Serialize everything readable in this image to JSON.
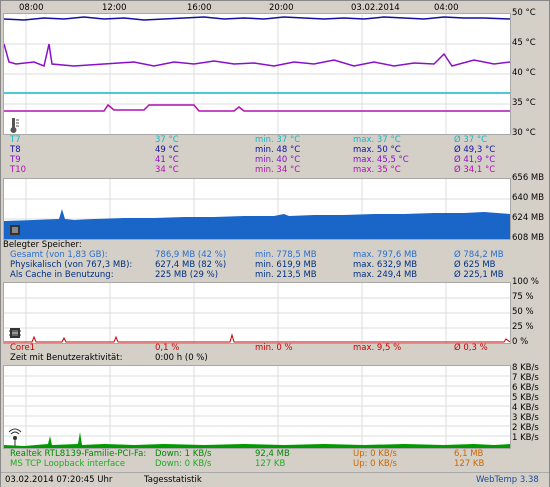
{
  "app": {
    "title": "WebTemp 3.38"
  },
  "time_axis": {
    "labels": [
      "08:00",
      "12:00",
      "16:00",
      "20:00",
      "03.02.2014",
      "04:00"
    ]
  },
  "temp_panel": {
    "y_labels": [
      "50 °C",
      "45 °C",
      "40 °C",
      "35 °C",
      "30 °C"
    ],
    "rows": [
      {
        "name": "T7",
        "current": "37 °C",
        "min": "min.  37 °C",
        "max": "max.  37 °C",
        "avg": "Ø 37 °C",
        "color": "#11b8c8"
      },
      {
        "name": "T8",
        "current": "49 °C",
        "min": "min.  48 °C",
        "max": "max.  50 °C",
        "avg": "Ø 49,3 °C",
        "color": "#1010a0"
      },
      {
        "name": "T9",
        "current": "41 °C",
        "min": "min.  40 °C",
        "max": "max.  45,5 °C",
        "avg": "Ø 41,9 °C",
        "color": "#8a10c8"
      },
      {
        "name": "T10",
        "current": "34 °C",
        "min": "min.  34 °C",
        "max": "max.  35 °C",
        "avg": "Ø 34,1 °C",
        "color": "#b010b0"
      }
    ],
    "chart_data": {
      "type": "line",
      "ylim": [
        30,
        50
      ],
      "series": [
        {
          "name": "T7",
          "values": [
            37,
            37,
            37,
            37,
            37,
            37,
            37,
            37,
            37,
            37,
            37,
            37
          ]
        },
        {
          "name": "T8",
          "values": [
            49,
            49.5,
            49,
            49,
            49.5,
            49,
            49,
            49.3,
            49,
            49,
            49.5,
            49
          ]
        },
        {
          "name": "T9",
          "values": [
            41,
            41,
            41.5,
            41,
            41,
            42,
            41,
            41.5,
            42,
            41,
            41,
            41
          ]
        },
        {
          "name": "T10",
          "values": [
            34,
            34,
            34,
            34,
            35,
            35,
            34,
            34,
            34,
            34,
            34,
            34
          ]
        }
      ]
    }
  },
  "mem_panel": {
    "y_labels": [
      "656 MB",
      "640 MB",
      "624 MB",
      "608 MB"
    ],
    "header": "Belegter Speicher:",
    "rows": [
      {
        "name": "Gesamt (von 1,83 GB):",
        "current": "786,9 MB (42 %)",
        "min": "min.  778,5 MB",
        "max": "max.  797,6 MB",
        "avg": "Ø 784,2 MB",
        "color": "#2a6ecc"
      },
      {
        "name": "Physikalisch (von 767,3 MB):",
        "current": "627,4 MB (82 %)",
        "min": "min.  619,9 MB",
        "max": "max.  632,9 MB",
        "avg": "Ø 625 MB",
        "color": "#003080"
      },
      {
        "name": "Als Cache in Benutzung:",
        "current": "225 MB (29 %)",
        "min": "min.  213,5 MB",
        "max": "max.  249,4 MB",
        "avg": "Ø 225,1 MB",
        "color": "#003080"
      }
    ],
    "chart_data": {
      "type": "area",
      "ylim": [
        608,
        656
      ],
      "values": [
        620,
        621,
        622,
        622,
        623,
        623,
        624,
        624,
        625,
        625,
        625,
        626
      ]
    }
  },
  "cpu_panel": {
    "y_labels": [
      "100 %",
      "75 %",
      "50 %",
      "25 %",
      "0 %"
    ],
    "rows": [
      {
        "name": "Core1",
        "current": "0,1 %",
        "min": "min.  0 %",
        "max": "max.  9,5 %",
        "avg": "Ø 0,3 %",
        "color": "#cc0000"
      }
    ],
    "activity_label": "Zeit mit Benutzeraktivität:",
    "activity_value": "0:00 h (0 %)"
  },
  "net_panel": {
    "y_labels": [
      "8 KB/s",
      "7 KB/s",
      "6 KB/s",
      "5 KB/s",
      "4 KB/s",
      "3 KB/s",
      "2 KB/s",
      "1 KB/s"
    ],
    "rows": [
      {
        "name": "Realtek RTL8139-Familie-PCI-Fa:",
        "down": "Down: 1 KB/s",
        "down_total": "92,4 MB",
        "up": "Up: 0 KB/s",
        "up_total": "6,1 MB",
        "color": "#008800"
      },
      {
        "name": "MS TCP Loopback interface",
        "down": "Down: 0 KB/s",
        "down_total": "127 KB",
        "up": "Up: 0 KB/s",
        "up_total": "127 KB",
        "color": "#22aa22"
      }
    ]
  },
  "status": {
    "datetime": "03.02.2014 07:20:45 Uhr",
    "tab": "Tagesstatistik",
    "brand": "WebTemp 3.38"
  },
  "colors": {
    "up": "#cc6600",
    "brand": "#1a4aa0"
  }
}
